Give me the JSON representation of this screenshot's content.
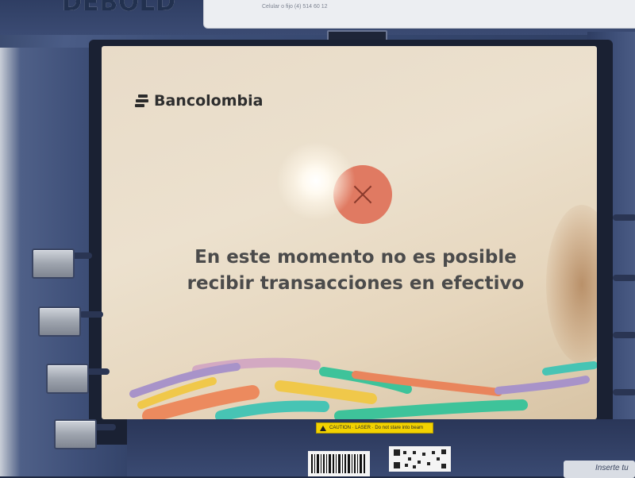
{
  "top": {
    "brand": "DEBOLD",
    "sticker_text": "Celular o fijo (4) 514 60 12"
  },
  "screen": {
    "logo_text": "Bancolombia",
    "message_line1": "En este momento no es posible",
    "message_line2": "recibir transacciones en efectivo",
    "status_icon": "error-x-icon",
    "colors": {
      "error_circle": "#e07a62",
      "background": "#e8dbc8",
      "text": "#4b4b4b"
    }
  },
  "bottom": {
    "caution_text": "CAUTION · LASER · Do not stare into beam",
    "insert_label": "Inserte tu"
  }
}
